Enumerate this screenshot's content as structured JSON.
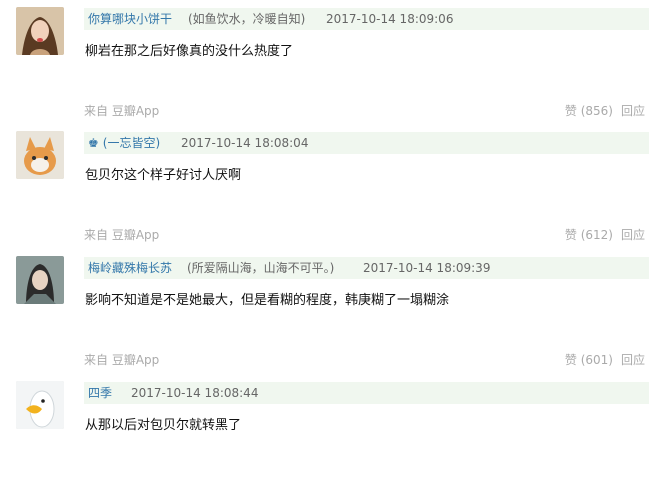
{
  "comments": [
    {
      "author": "你算哪块小饼干",
      "signature": "(如鱼饮水，冷暖自知)",
      "time": "2017-10-14 18:09:06",
      "content": "柳岩在那之后好像真的没什么热度了",
      "source": "来自 豆瓣App",
      "like": "赞 (856)",
      "reply": "回应"
    },
    {
      "author": "(一忘皆空)",
      "signature": "",
      "time": "2017-10-14 18:08:04",
      "content": "包贝尔这个样子好讨人厌啊",
      "source": "来自 豆瓣App",
      "like": "赞 (612)",
      "reply": "回应"
    },
    {
      "author": "梅岭藏殊梅长苏",
      "signature": "(所爱隔山海，山海不可平。)",
      "time": "2017-10-14 18:09:39",
      "content": "影响不知道是不是她最大，但是看糊的程度，韩庚糊了一塌糊涂",
      "source": "来自 豆瓣App",
      "like": "赞 (601)",
      "reply": "回应"
    },
    {
      "author": "四季",
      "signature": "",
      "time": "2017-10-14 18:08:44",
      "content": "从那以后对包贝尔就转黑了",
      "source": "",
      "like": "",
      "reply": ""
    }
  ],
  "icons": [
    "star-badge-icon"
  ],
  "colors": {
    "author": "#3377aa",
    "header_bg": "#f0f7ef",
    "meta": "#aaaaaa"
  }
}
